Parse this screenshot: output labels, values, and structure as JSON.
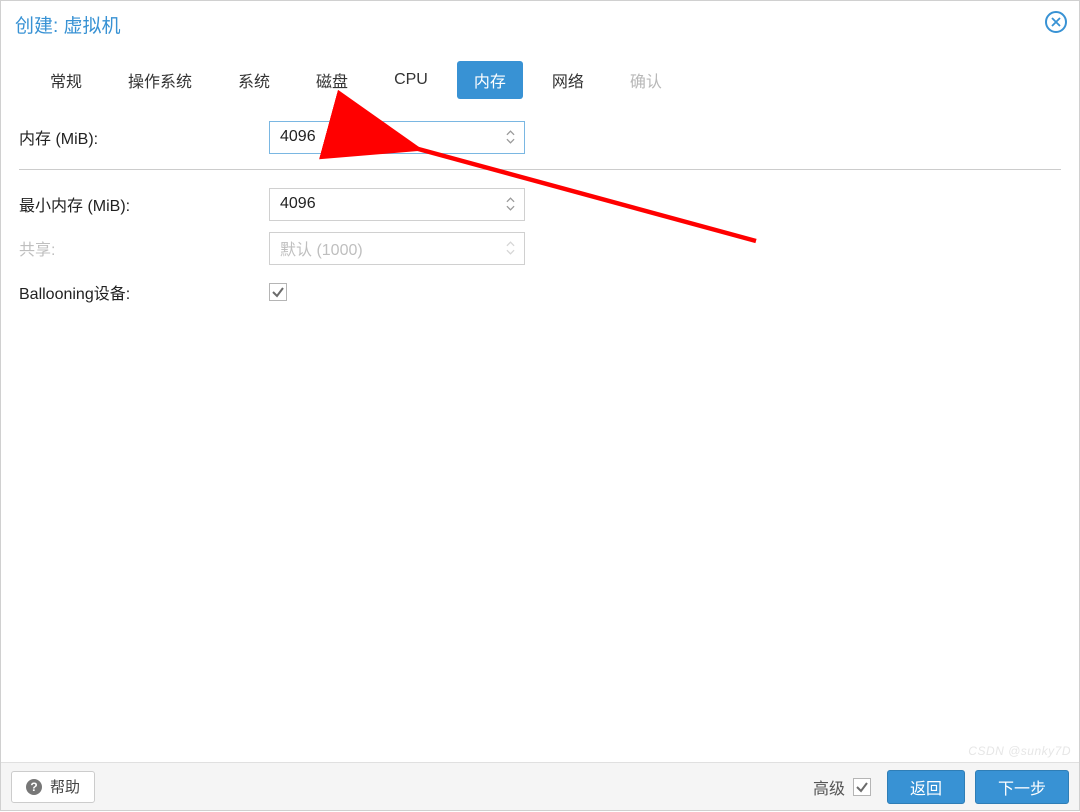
{
  "header": {
    "title": "创建: 虚拟机"
  },
  "tabs": {
    "items": [
      {
        "label": "常规"
      },
      {
        "label": "操作系统"
      },
      {
        "label": "系统"
      },
      {
        "label": "磁盘"
      },
      {
        "label": "CPU"
      },
      {
        "label": "内存",
        "active": true
      },
      {
        "label": "网络"
      },
      {
        "label": "确认",
        "disabled": true
      }
    ]
  },
  "form": {
    "memory_label": "内存 (MiB):",
    "memory_value": "4096",
    "min_memory_label": "最小内存 (MiB):",
    "min_memory_value": "4096",
    "shares_label": "共享:",
    "shares_value": "默认 (1000)",
    "ballooning_label": "Ballooning设备:",
    "ballooning_checked": true
  },
  "footer": {
    "help_label": "帮助",
    "advanced_label": "高级",
    "advanced_checked": true,
    "back_label": "返回",
    "next_label": "下一步"
  },
  "watermark": "CSDN @sunky7D"
}
